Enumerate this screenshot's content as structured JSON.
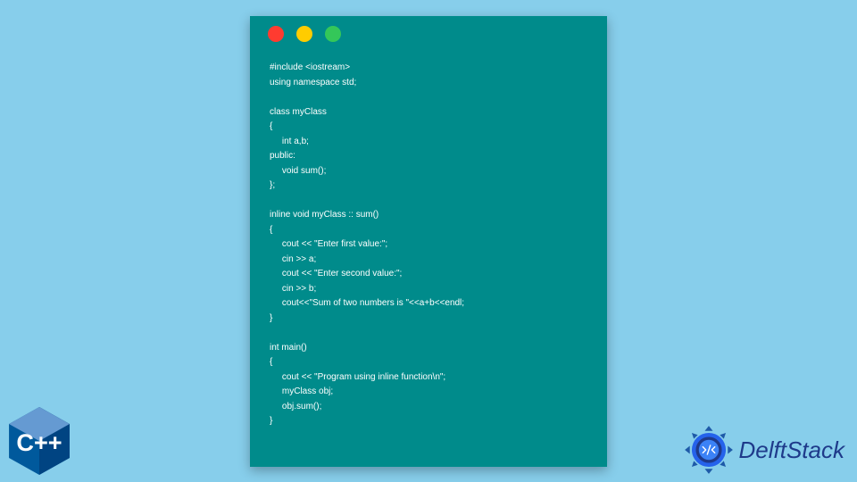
{
  "code_window": {
    "traffic_lights": [
      "red",
      "yellow",
      "green"
    ],
    "code": "#include <iostream>\nusing namespace std;\n\nclass myClass\n{\n     int a,b;\npublic:\n     void sum();\n};\n\ninline void myClass :: sum()\n{\n     cout << \"Enter first value:\";\n     cin >> a;\n     cout << \"Enter second value:\";\n     cin >> b;\n     cout<<\"Sum of two numbers is \"<<a+b<<endl;\n}\n\nint main()\n{\n     cout << \"Program using inline function\\n\";\n     myClass obj;\n     obj.sum();\n}"
  },
  "cpp_logo": {
    "label": "C++",
    "colors": {
      "top": "#6295cb",
      "left": "#00427e",
      "right": "#004482"
    }
  },
  "brand": {
    "name": "DelftStack",
    "colors": {
      "primary": "#1e3a8a",
      "accent": "#3b82f6"
    }
  }
}
